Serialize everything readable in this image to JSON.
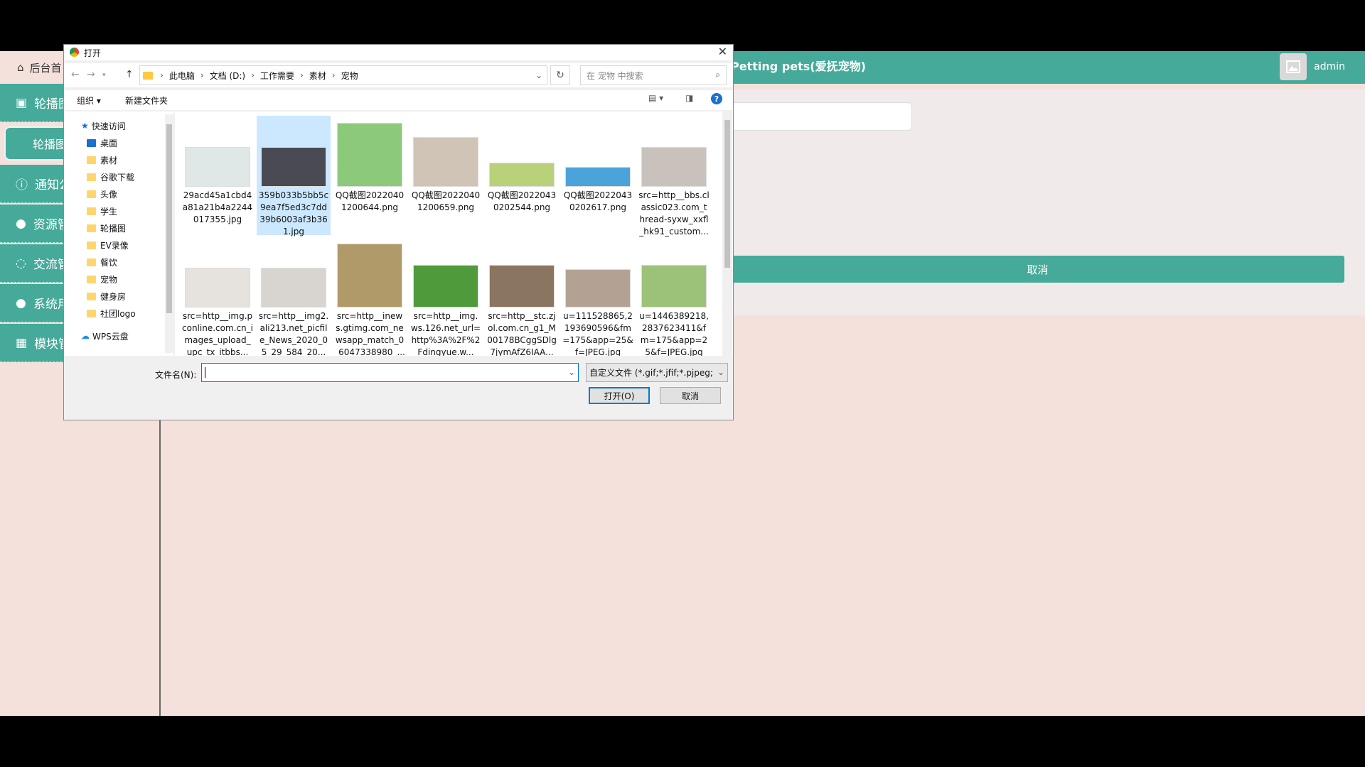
{
  "app": {
    "home_label": "后台首",
    "header_title": "Petting pets(爱抚宠物)",
    "user": "admin",
    "sidebar": [
      {
        "label": "轮播图"
      },
      {
        "label": "通知公"
      },
      {
        "label": "资源管"
      },
      {
        "label": "交流管"
      },
      {
        "label": "系统用"
      },
      {
        "label": "模块管"
      }
    ],
    "sidebar_sub": "轮播图",
    "cancel_button": "取消"
  },
  "dialog": {
    "title": "打开",
    "breadcrumbs": [
      "此电脑",
      "文档 (D:)",
      "工作需要",
      "素材",
      "宠物"
    ],
    "search_placeholder": "在 宠物 中搜索",
    "toolbar": {
      "organize": "组织 ▾",
      "new_folder": "新建文件夹"
    },
    "nav": [
      {
        "label": "快速访问",
        "pin": false
      },
      {
        "label": "桌面",
        "pin": true
      },
      {
        "label": "素材",
        "pin": true
      },
      {
        "label": "谷歌下载",
        "pin": true
      },
      {
        "label": "头像",
        "pin": true
      },
      {
        "label": "学生",
        "pin": true
      },
      {
        "label": "轮播图",
        "pin": true
      },
      {
        "label": "EV录像",
        "pin": true
      },
      {
        "label": "餐饮",
        "pin": false
      },
      {
        "label": "宠物",
        "pin": false
      },
      {
        "label": "健身房",
        "pin": false
      },
      {
        "label": "社团logo",
        "pin": false
      },
      {
        "label": "WPS云盘",
        "pin": false
      }
    ],
    "files": [
      {
        "name": "29acd45a1cbd4a81a21b4a2244017355.jpg",
        "color": "#dfe8e6"
      },
      {
        "name": "359b033b5bb5c9ea7f5ed3c7dd39b6003af3b361.jpg",
        "color": "#4a4a55"
      },
      {
        "name": "QQ截图20220401200644.png",
        "color": "#8cc97a"
      },
      {
        "name": "QQ截图20220401200659.png",
        "color": "#cfc4b6"
      },
      {
        "name": "QQ截图20220430202544.png",
        "color": "#b9d27a"
      },
      {
        "name": "QQ截图20220430202617.png",
        "color": "#4aa3d9"
      },
      {
        "name": "src=http__bbs.classic023.com_thread-syxw_xxfl_hk91_custom...",
        "color": "#c9c2bc"
      },
      {
        "name": "src=http__img.pconline.com.cn_images_upload_upc_tx_itbbs...",
        "color": "#e6e2de"
      },
      {
        "name": "src=http__img2.ali213.net_picfile_News_2020_05_29_584_20...",
        "color": "#d8d4cf"
      },
      {
        "name": "src=http__inews.gtimg.com_newsapp_match_0_6047338980_...",
        "color": "#b09a6a"
      },
      {
        "name": "src=http__img.ws.126.net_url=http%3A%2F%2Fdingyue.w...",
        "color": "#4f9a3a"
      },
      {
        "name": "src=http__stc.zjol.com.cn_g1_M00178BCggSDlg7jymAfZ6IAA...",
        "color": "#8a7560"
      },
      {
        "name": "u=111528865,2193690596&fm=175&app=25&f=JPEG.jpg",
        "color": "#b3a294"
      },
      {
        "name": "u=1446389218,2837623411&fm=175&app=25&f=JPEG.jpg",
        "color": "#9cc27a"
      }
    ],
    "filename_label": "文件名(N):",
    "filename_value": "",
    "filter_value": "自定义文件 (*.gif;*.jfif;*.pjpeg;",
    "open_button": "打开(O)",
    "cancel_button": "取消"
  }
}
